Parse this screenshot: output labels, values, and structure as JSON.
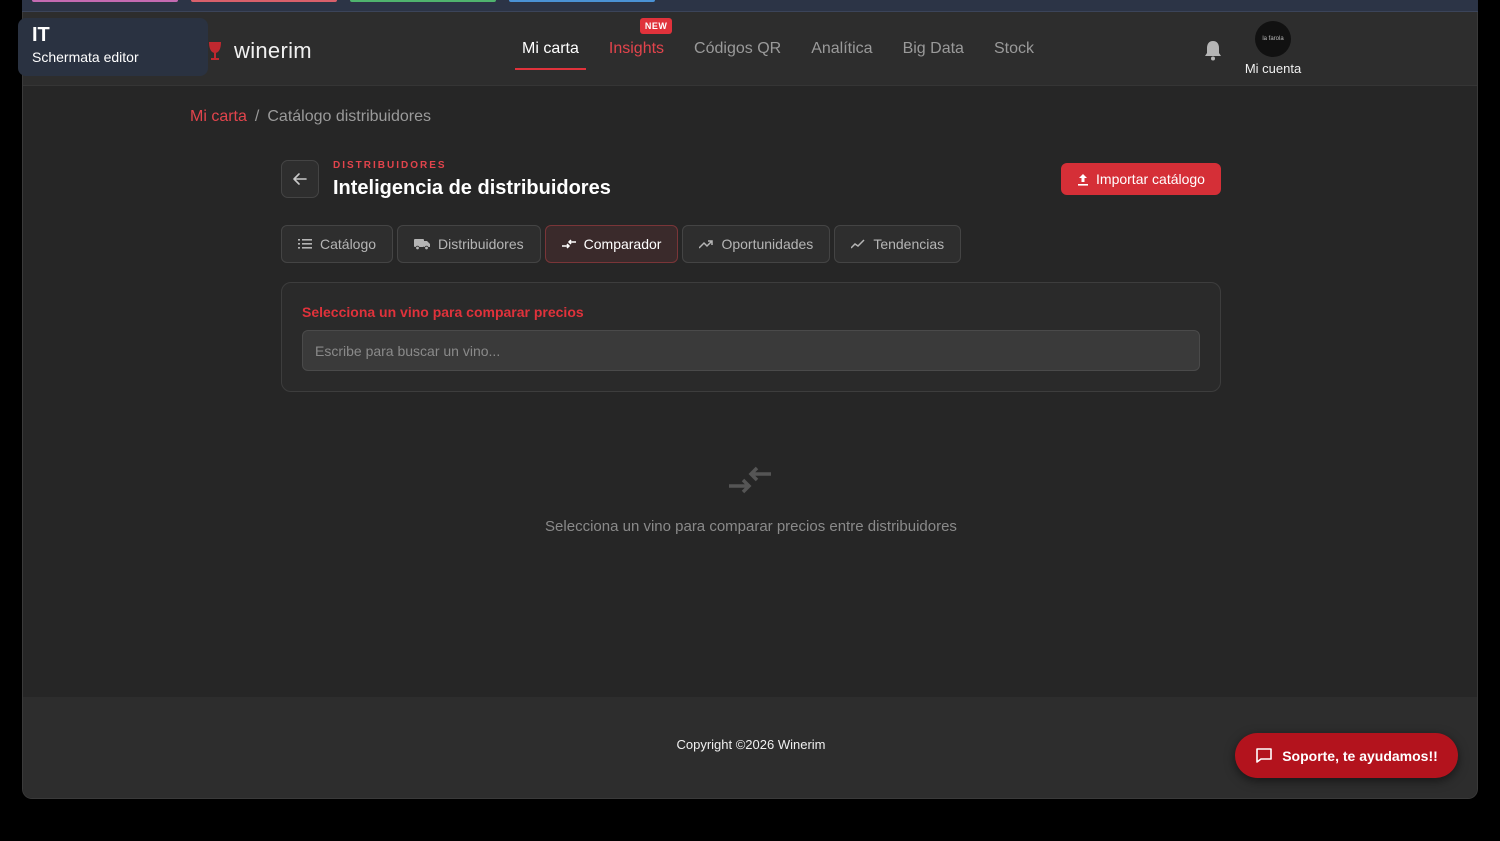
{
  "colors": {
    "accent": "#e0323b",
    "support": "#b3131d",
    "background": "#262626"
  },
  "language_tooltip": {
    "code": "IT",
    "label": "Schermata editor"
  },
  "brand": {
    "name": "winerim"
  },
  "nav": {
    "items": [
      {
        "label": "Mi carta",
        "active": true
      },
      {
        "label": "Insights",
        "badge": "NEW"
      },
      {
        "label": "Códigos QR"
      },
      {
        "label": "Analítica"
      },
      {
        "label": "Big Data"
      },
      {
        "label": "Stock"
      }
    ]
  },
  "account": {
    "label": "Mi cuenta",
    "avatar_text": "la farola"
  },
  "breadcrumb": {
    "home": "Mi carta",
    "separator": "/",
    "current": "Catálogo distribuidores"
  },
  "header": {
    "eyebrow": "DISTRIBUIDORES",
    "title": "Inteligencia de distribuidores",
    "import_button": "Importar catálogo"
  },
  "tabs": [
    {
      "label": "Catálogo",
      "icon": "list-icon"
    },
    {
      "label": "Distribuidores",
      "icon": "truck-icon"
    },
    {
      "label": "Comparador",
      "icon": "compare-arrows-icon",
      "active": true
    },
    {
      "label": "Oportunidades",
      "icon": "trending-up-icon"
    },
    {
      "label": "Tendencias",
      "icon": "trend-line-icon"
    }
  ],
  "compare_panel": {
    "label": "Selecciona un vino para comparar precios",
    "search_placeholder": "Escribe para buscar un vino..."
  },
  "empty_state": {
    "icon": "compare-arrows-icon",
    "text": "Selecciona un vino para comparar precios entre distribuidores"
  },
  "footer": {
    "copyright": "Copyright ©2026 Winerim"
  },
  "support_button": {
    "label": "Soporte, te ayudamos!!",
    "icon": "chat-icon"
  }
}
